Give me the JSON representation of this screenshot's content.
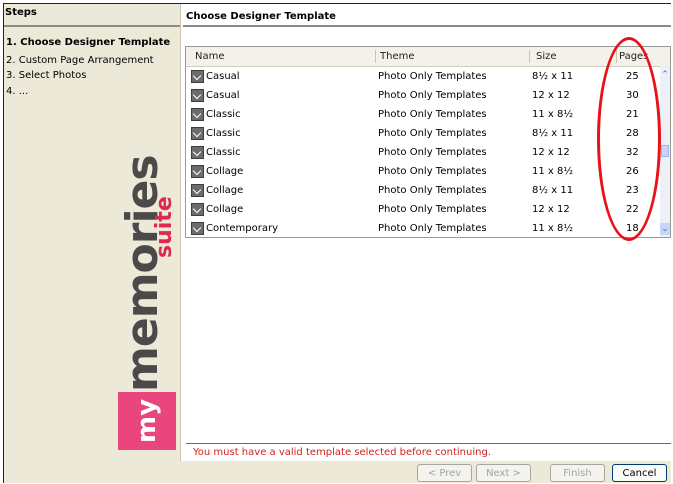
{
  "steps": {
    "title": "Steps",
    "items": [
      {
        "label": "1. Choose Designer Template",
        "active": true
      },
      {
        "label": "2. Custom Page Arrangement",
        "active": false
      },
      {
        "label": "3. Select Photos",
        "active": false
      },
      {
        "label": "4. ...",
        "active": false
      }
    ]
  },
  "logo": {
    "prefix": "my",
    "word": "memories",
    "suffix": "suite"
  },
  "main": {
    "title": "Choose Designer Template",
    "columns": {
      "name": "Name",
      "theme": "Theme",
      "size": "Size",
      "pages": "Pages"
    },
    "rows": [
      {
        "name": "Casual",
        "theme": "Photo Only Templates",
        "size": "8½ x 11",
        "pages": "25"
      },
      {
        "name": "Casual",
        "theme": "Photo Only Templates",
        "size": "12 x 12",
        "pages": "30"
      },
      {
        "name": "Classic",
        "theme": "Photo Only Templates",
        "size": "11 x 8½",
        "pages": "21"
      },
      {
        "name": "Classic",
        "theme": "Photo Only Templates",
        "size": "8½ x 11",
        "pages": "28"
      },
      {
        "name": "Classic",
        "theme": "Photo Only Templates",
        "size": "12 x 12",
        "pages": "32"
      },
      {
        "name": "Collage",
        "theme": "Photo Only Templates",
        "size": "11 x 8½",
        "pages": "26"
      },
      {
        "name": "Collage",
        "theme": "Photo Only Templates",
        "size": "8½ x 11",
        "pages": "23"
      },
      {
        "name": "Collage",
        "theme": "Photo Only Templates",
        "size": "12 x 12",
        "pages": "22"
      },
      {
        "name": "Contemporary",
        "theme": "Photo Only Templates",
        "size": "11 x 8½",
        "pages": "18"
      }
    ],
    "error": "You must have a valid template selected before continuing."
  },
  "buttons": {
    "prev": "< Prev",
    "next": "Next >",
    "finish": "Finish",
    "cancel": "Cancel"
  },
  "colors": {
    "annotation": "#e8131a",
    "error": "#d11f1f",
    "logo_pink": "#e8467c",
    "logo_red": "#e0284f"
  }
}
